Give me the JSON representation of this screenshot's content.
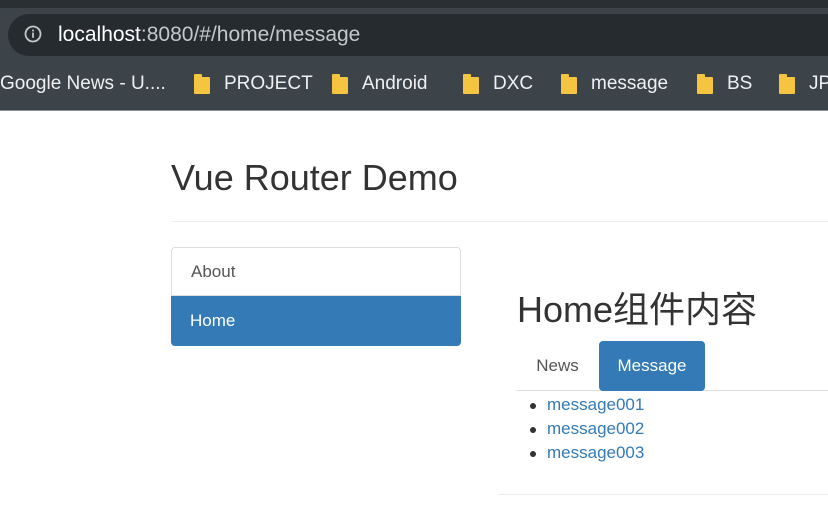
{
  "browser": {
    "url_host": "localhost",
    "url_rest": ":8080/#/home/message",
    "info_icon": "info-circle-icon",
    "bookmarks": [
      {
        "label": "Google News - U....",
        "icon": "none"
      },
      {
        "label": "PROJECT",
        "icon": "folder-icon"
      },
      {
        "label": "Android",
        "icon": "folder-icon"
      },
      {
        "label": "DXC",
        "icon": "folder-icon"
      },
      {
        "label": "message",
        "icon": "folder-icon"
      },
      {
        "label": "BS",
        "icon": "folder-icon"
      },
      {
        "label": "JPA",
        "icon": "folder-icon"
      }
    ]
  },
  "page": {
    "title": "Vue Router Demo"
  },
  "nav": {
    "items": [
      {
        "label": "About",
        "active": false
      },
      {
        "label": "Home",
        "active": true
      }
    ]
  },
  "home": {
    "title": "Home组件内容",
    "tabs": [
      {
        "label": "News",
        "active": false
      },
      {
        "label": "Message",
        "active": true
      }
    ],
    "messages": [
      "message001",
      "message002",
      "message003"
    ]
  },
  "colors": {
    "accent": "#337ab7",
    "toolbar": "#3c444a",
    "omnibox": "#262b30"
  }
}
